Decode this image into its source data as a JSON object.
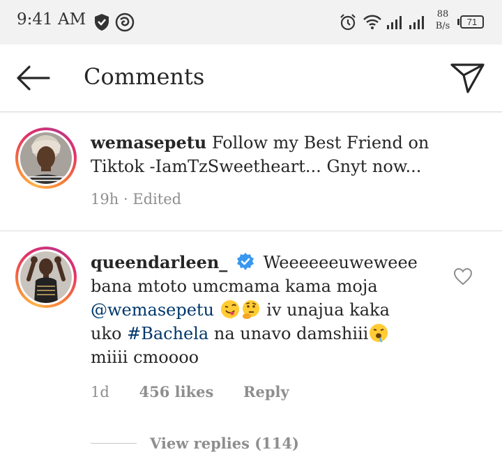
{
  "status_bar": {
    "time": "9:41 AM",
    "net_speed_value": "88",
    "net_speed_unit": "B/s",
    "battery": "71",
    "icons": [
      "shield-icon",
      "vpn-icon",
      "alarm-icon",
      "wifi-icon",
      "signal-icon",
      "signal-icon"
    ]
  },
  "header": {
    "title": "Comments",
    "back_icon": "arrow-left-icon",
    "share_icon": "paper-plane-icon"
  },
  "comments": [
    {
      "username": "wemasepetu",
      "text_line1": "Follow my Best Friend on",
      "text_line2": "Tiktok -IamTzSweetheart... Gnyt now...",
      "time": "19h",
      "separator": "·",
      "edited": "Edited"
    },
    {
      "username": "queendarleen_",
      "verified_icon": "verified-badge-icon",
      "text_line1": "Weeeeeeuweweee",
      "text_line2": "bana mtoto umcmama kama moja",
      "mention": "@wemasepetu",
      "text_line3_rest": "iv unajua kaka",
      "text_line4_start": "uko",
      "hashtag": "#Bachela",
      "text_line4_rest": "na unavo damshiii",
      "text_line5": "miiii cmoooo",
      "time": "1d",
      "likes": "456 likes",
      "reply": "Reply",
      "like_icon": "heart-icon",
      "view_replies": "View replies (114)"
    }
  ],
  "colors": {
    "link": "#00376b",
    "meta": "#8e8e8e",
    "text": "#262626",
    "verified": "#3897f0",
    "status_bar_bg": "#f2f2f2"
  }
}
